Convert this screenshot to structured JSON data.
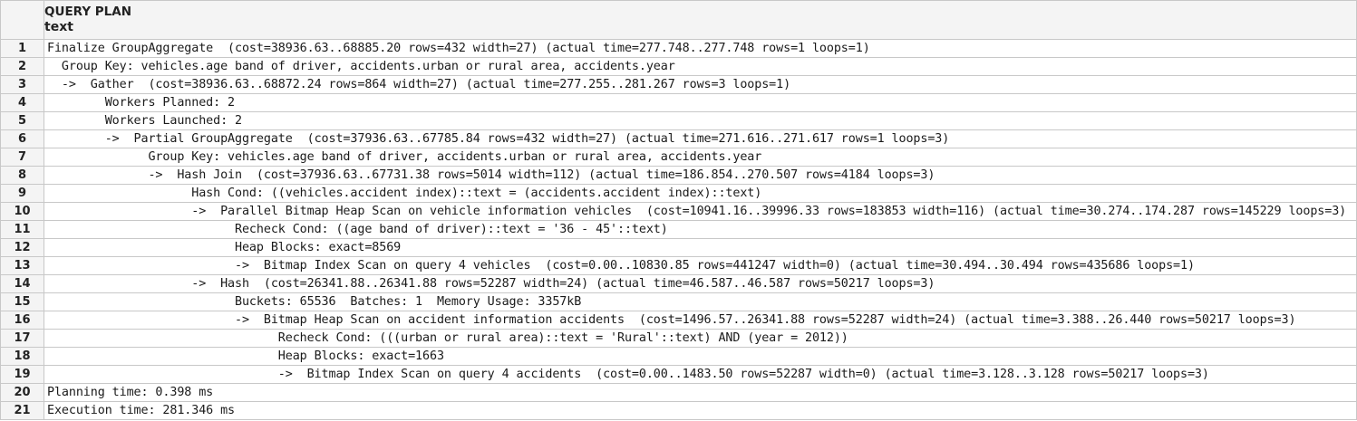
{
  "header": {
    "column_name": "QUERY PLAN",
    "column_type": "text",
    "rownum_header": ""
  },
  "rows": [
    {
      "n": "1",
      "text": "Finalize GroupAggregate  (cost=38936.63..68885.20 rows=432 width=27) (actual time=277.748..277.748 rows=1 loops=1)"
    },
    {
      "n": "2",
      "text": "  Group Key: vehicles.age band of driver, accidents.urban or rural area, accidents.year"
    },
    {
      "n": "3",
      "text": "  ->  Gather  (cost=38936.63..68872.24 rows=864 width=27) (actual time=277.255..281.267 rows=3 loops=1)"
    },
    {
      "n": "4",
      "text": "        Workers Planned: 2"
    },
    {
      "n": "5",
      "text": "        Workers Launched: 2"
    },
    {
      "n": "6",
      "text": "        ->  Partial GroupAggregate  (cost=37936.63..67785.84 rows=432 width=27) (actual time=271.616..271.617 rows=1 loops=3)"
    },
    {
      "n": "7",
      "text": "              Group Key: vehicles.age band of driver, accidents.urban or rural area, accidents.year"
    },
    {
      "n": "8",
      "text": "              ->  Hash Join  (cost=37936.63..67731.38 rows=5014 width=112) (actual time=186.854..270.507 rows=4184 loops=3)"
    },
    {
      "n": "9",
      "text": "                    Hash Cond: ((vehicles.accident index)::text = (accidents.accident index)::text)"
    },
    {
      "n": "10",
      "text": "                    ->  Parallel Bitmap Heap Scan on vehicle information vehicles  (cost=10941.16..39996.33 rows=183853 width=116) (actual time=30.274..174.287 rows=145229 loops=3)"
    },
    {
      "n": "11",
      "text": "                          Recheck Cond: ((age band of driver)::text = '36 - 45'::text)"
    },
    {
      "n": "12",
      "text": "                          Heap Blocks: exact=8569"
    },
    {
      "n": "13",
      "text": "                          ->  Bitmap Index Scan on query 4 vehicles  (cost=0.00..10830.85 rows=441247 width=0) (actual time=30.494..30.494 rows=435686 loops=1)"
    },
    {
      "n": "14",
      "text": "                    ->  Hash  (cost=26341.88..26341.88 rows=52287 width=24) (actual time=46.587..46.587 rows=50217 loops=3)"
    },
    {
      "n": "15",
      "text": "                          Buckets: 65536  Batches: 1  Memory Usage: 3357kB"
    },
    {
      "n": "16",
      "text": "                          ->  Bitmap Heap Scan on accident information accidents  (cost=1496.57..26341.88 rows=52287 width=24) (actual time=3.388..26.440 rows=50217 loops=3)"
    },
    {
      "n": "17",
      "text": "                                Recheck Cond: (((urban or rural area)::text = 'Rural'::text) AND (year = 2012))"
    },
    {
      "n": "18",
      "text": "                                Heap Blocks: exact=1663"
    },
    {
      "n": "19",
      "text": "                                ->  Bitmap Index Scan on query 4 accidents  (cost=0.00..1483.50 rows=52287 width=0) (actual time=3.128..3.128 rows=50217 loops=3)"
    },
    {
      "n": "20",
      "text": "Planning time: 0.398 ms"
    },
    {
      "n": "21",
      "text": "Execution time: 281.346 ms"
    }
  ]
}
